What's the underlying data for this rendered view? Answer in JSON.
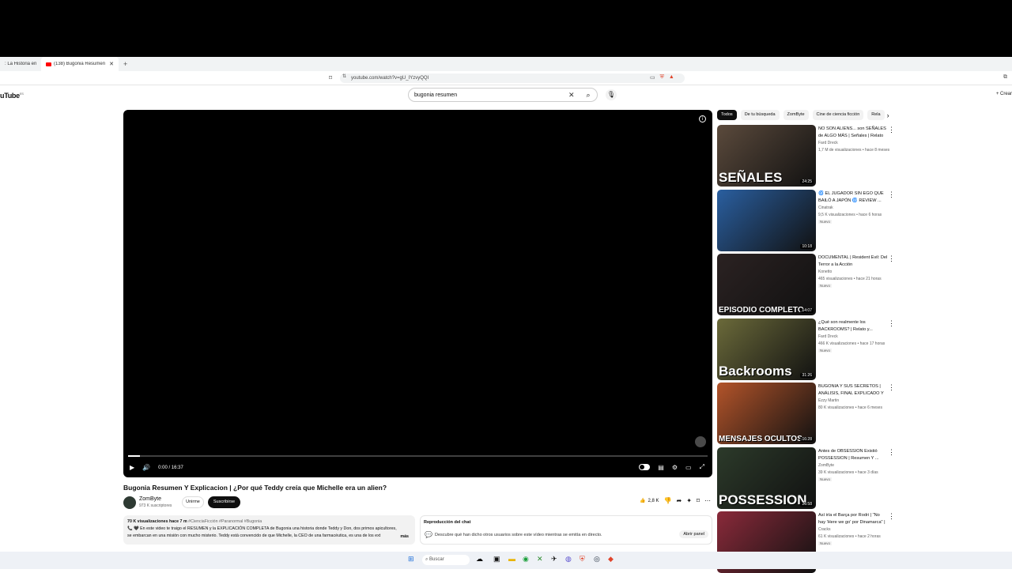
{
  "browser": {
    "tabs": [
      {
        "label": ": La Historia en T..."
      },
      {
        "label": "(138) Bugonia Resumen Y Explic"
      }
    ],
    "new_tab": "+",
    "url": "youtube.com/watch?v=gU_IYzvyQQI"
  },
  "header": {
    "logo": "uTube",
    "logo_sup": "ES",
    "search_value": "bugonia resumen",
    "create_label": "+ Crear"
  },
  "player": {
    "time": "0:00 / 16:37",
    "progress": 0.02
  },
  "video": {
    "title": "Bugonia Resumen Y Explicacion | ¿Por qué Teddy creía que Michelle era un alien?",
    "channel": "ZomByte",
    "subscribers": "973 K suscriptores",
    "join_label": "Unirme",
    "subscribe_label": "Suscribirse",
    "likes": "2,8 K",
    "description": {
      "meta": "70 K visualizaciones  hace 7 m",
      "tags": " #CienciaFicción #Paranormal #Bugonia",
      "line1": "📞 🖤 En este video te traigo el RESUMEN y la EXPLICACIÓN COMPLETA de Bugonia una historia donde Teddy y Don, dos primos apicultores,",
      "line2": "se embarcan en una misión con mucho misterio. Teddy está convencido de que Michelle, la CEO de una farmacéutica, es una de los ext",
      "more": "más"
    }
  },
  "chat": {
    "header": "Reproducción del chat",
    "text": "Descubre qué han dicho otros usuarios sobre este vídeo mientras se emitía en directo.",
    "button": "Abrir panel"
  },
  "chips": [
    "Todos",
    "De tu búsqueda",
    "ZomByte",
    "Cine de ciencia ficción",
    "Rela"
  ],
  "recommendations": [
    {
      "title": "NO SON ALIENS... son SEÑALES de ALGO MÁS | Señales | Relato y...",
      "channel": "Fard Dreck",
      "meta": "1,7 M de visualizaciones • hace 8 meses",
      "duration": "24:25",
      "thumb_text": "SEÑALES",
      "new": "",
      "bg": "#5b4a3c"
    },
    {
      "title": "🌀 EL JUGADOR SIN EGO QUE BAILÓ A JAPÓN 🌀 REVIEW ...",
      "channel": "Cinatrak",
      "meta": "9,5 K visualizaciones • hace 6 horas",
      "duration": "10:18",
      "thumb_text": "",
      "new": "Nuevo",
      "bg": "#2a5fa0"
    },
    {
      "title": "DOCUMENTAL | Resident Evil: Del Terror a la Acción",
      "channel": "Konetto",
      "meta": "465 visualizaciones • hace 21 horas",
      "duration": "14:07",
      "thumb_text": "EPISODIO COMPLETO",
      "new": "Nuevo",
      "bg": "#2b2222"
    },
    {
      "title": "¿Qué son realmente los BACKROOMS? | Relato y...",
      "channel": "Fard Dreck",
      "meta": "466 K visualizaciones • hace 17 horas",
      "duration": "31:26",
      "thumb_text": "Backrooms",
      "new": "Nuevo",
      "bg": "#6b6a3a"
    },
    {
      "title": "BUGONIA Y SUS SECRETOS | ANÁLISIS, FINAL EXPLICADO Y ...",
      "channel": "Ezzy Martin",
      "meta": "80 K visualizaciones • hace 6 meses",
      "duration": "16:28",
      "thumb_text": "MENSAJES OCULTOS",
      "new": "",
      "bg": "#b3542a"
    },
    {
      "title": "Antes de OBSESSION Existió POSSESSION | Resumen Y ...",
      "channel": "ZomByte",
      "meta": "39 K visualizaciones • hace 3 días",
      "duration": "26:58",
      "thumb_text": "POSSESSION",
      "new": "Nuevo",
      "bg": "#2c3a2a"
    },
    {
      "title": "Así iría el Barça por Rodri | \"No hay 'Here we go' por Dinamarca\" | ...",
      "channel": "Cracks",
      "meta": "61 K visualizaciones • hace 2 horas",
      "duration": "",
      "thumb_text": "",
      "new": "Nuevo",
      "bg": "#8a2a3a"
    }
  ],
  "taskbar": {
    "search": "Buscar"
  }
}
